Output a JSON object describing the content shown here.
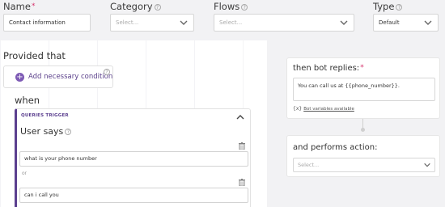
{
  "header": {
    "name": {
      "label": "Name",
      "required_mark": "*",
      "value": "Contact information"
    },
    "category": {
      "label": "Category",
      "help": "?",
      "placeholder": "Select..."
    },
    "flows": {
      "label": "Flows",
      "help": "?",
      "placeholder": "Select..."
    },
    "type": {
      "label": "Type",
      "help": "?",
      "value": "Default"
    }
  },
  "conditions": {
    "heading": "Provided that",
    "add_label": "Add necessary condition",
    "add_icon": "plus-icon",
    "help": "?"
  },
  "trigger": {
    "heading": "when",
    "title": "QUERIES TRIGGER",
    "user_says_label": "User says",
    "help": "?",
    "or_label": "or",
    "queries": [
      "what is your phone number",
      "can i call you"
    ]
  },
  "reply": {
    "label": "then bot replies:",
    "required_mark": "*",
    "text": "You can call us at {{phone_number}}.",
    "variables_icon": "braces-icon",
    "variables_link": "Bot variables available"
  },
  "action": {
    "label": "and performs action:",
    "placeholder": "Select..."
  },
  "colors": {
    "accent": "#5b3f8f",
    "accent_light": "#7e5bb5",
    "background": "#f2f2f4",
    "required": "#d6336c"
  }
}
